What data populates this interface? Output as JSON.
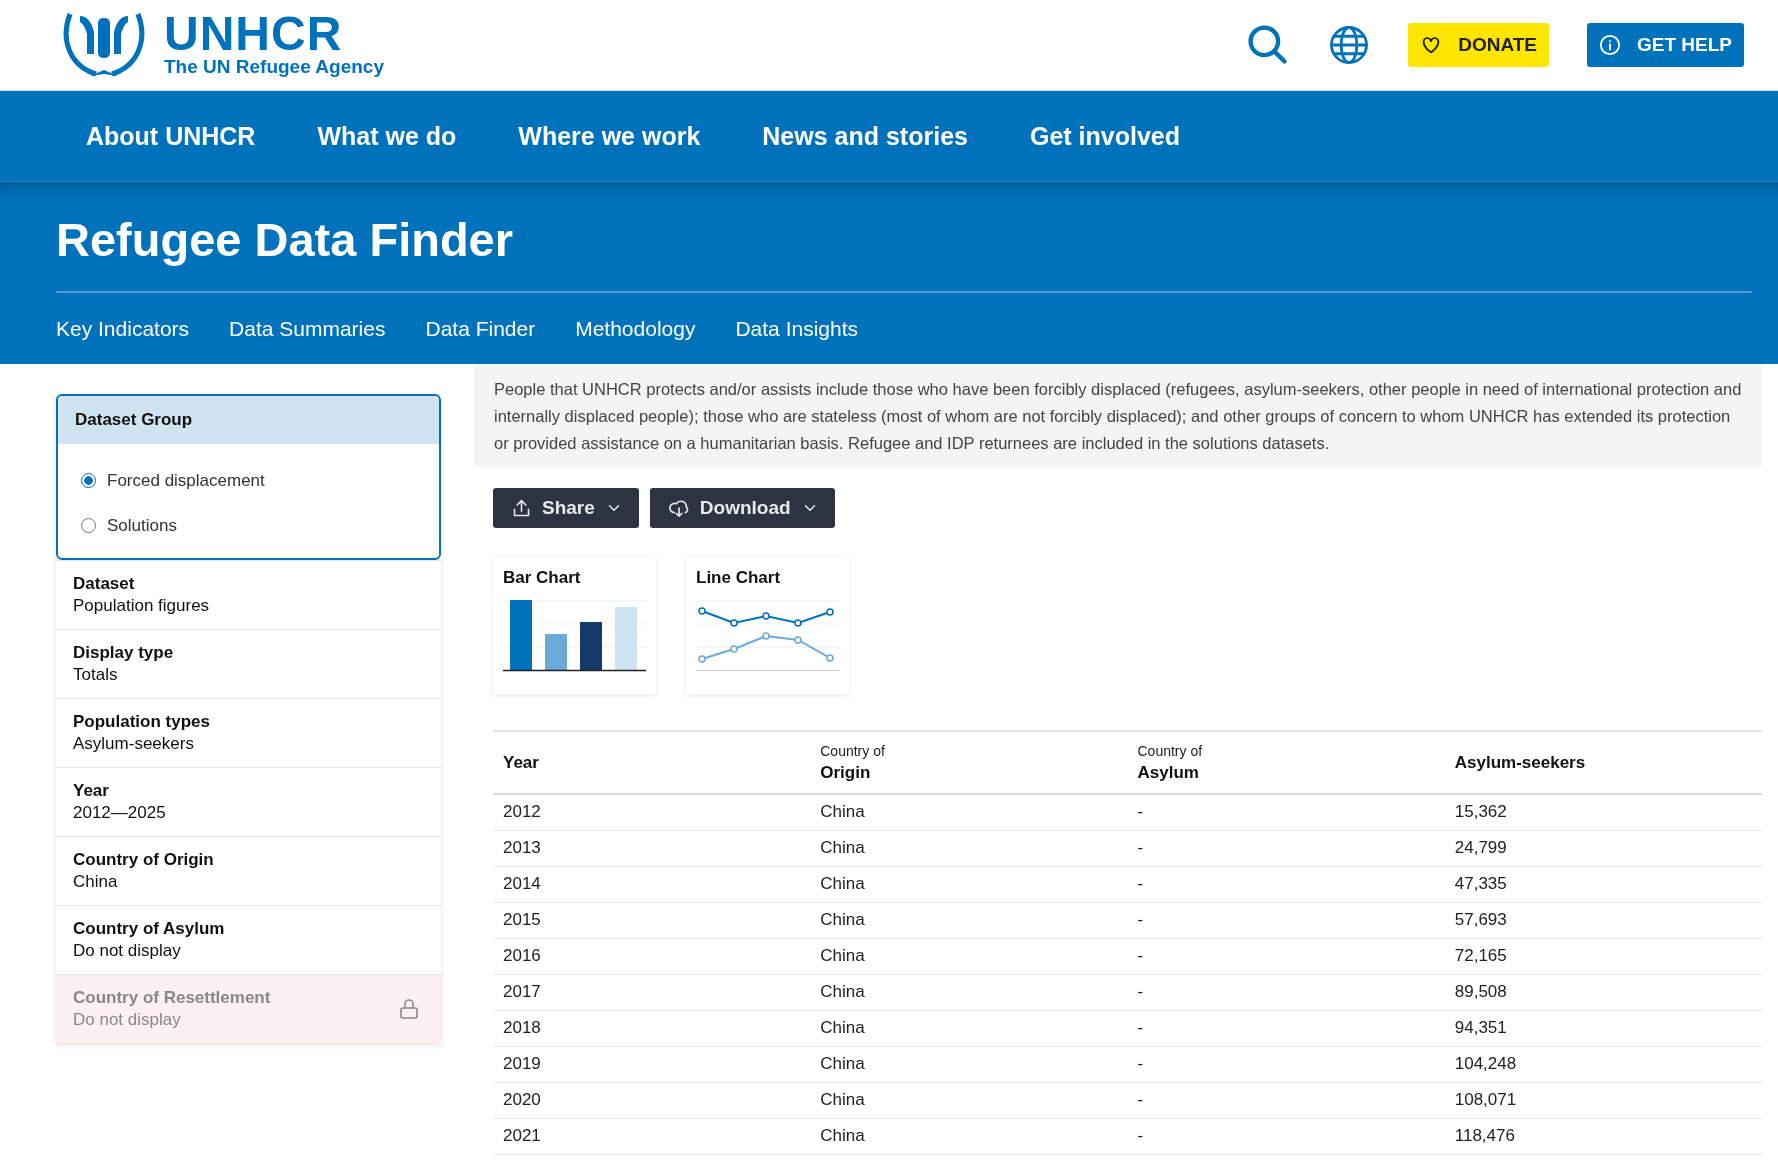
{
  "header": {
    "logo": {
      "name": "UNHCR",
      "tagline": "The UN Refugee Agency"
    },
    "actions": [
      {
        "kind": "search"
      },
      {
        "kind": "language"
      },
      {
        "kind": "donate",
        "label": "DONATE"
      },
      {
        "kind": "help",
        "label": "GET HELP"
      }
    ]
  },
  "nav": {
    "items": [
      "About UNHCR",
      "What we do",
      "Where we work",
      "News and stories",
      "Get involved"
    ]
  },
  "page_title": "Refugee Data Finder",
  "subnav": {
    "items": [
      "Key Indicators",
      "Data Summaries",
      "Data Finder",
      "Methodology",
      "Data Insights"
    ]
  },
  "sidebar": {
    "dataset_group": {
      "title": "Dataset Group",
      "options": [
        {
          "label": "Forced displacement",
          "selected": true
        },
        {
          "label": "Solutions",
          "selected": false
        }
      ]
    },
    "filters": [
      {
        "label": "Dataset",
        "value": "Population figures",
        "disabled": false
      },
      {
        "label": "Display type",
        "value": "Totals",
        "disabled": false
      },
      {
        "label": "Population types",
        "value": "Asylum-seekers",
        "disabled": false
      },
      {
        "label": "Year",
        "value": "2012—2025",
        "disabled": false
      },
      {
        "label": "Country of Origin",
        "value": "China",
        "disabled": false
      },
      {
        "label": "Country of Asylum",
        "value": "Do not display",
        "disabled": false
      },
      {
        "label": "Country of Resettlement",
        "value": "Do not display",
        "disabled": true
      }
    ]
  },
  "description": "People that UNHCR protects and/or assists include those who have been forcibly displaced (refugees, asylum-seekers, other people in need of international protection and internally displaced people); those who are stateless (most of whom are not forcibly displaced); and other groups of concern to whom UNHCR has extended its protection or provided assistance on a humanitarian basis. Refugee and IDP returnees are included in the solutions datasets.",
  "toolbar": [
    {
      "kind": "share",
      "label": "Share"
    },
    {
      "kind": "download",
      "label": "Download"
    }
  ],
  "chart_types": [
    {
      "kind": "bar",
      "label": "Bar Chart"
    },
    {
      "kind": "line",
      "label": "Line Chart"
    }
  ],
  "table": {
    "columns": [
      {
        "label": "Year"
      },
      {
        "prefix": "Country of",
        "label": "Origin"
      },
      {
        "prefix": "Country of",
        "label": "Asylum"
      },
      {
        "label": "Asylum-seekers"
      }
    ],
    "rows": [
      [
        "2012",
        "China",
        "-",
        "15,362"
      ],
      [
        "2013",
        "China",
        "-",
        "24,799"
      ],
      [
        "2014",
        "China",
        "-",
        "47,335"
      ],
      [
        "2015",
        "China",
        "-",
        "57,693"
      ],
      [
        "2016",
        "China",
        "-",
        "72,165"
      ],
      [
        "2017",
        "China",
        "-",
        "89,508"
      ],
      [
        "2018",
        "China",
        "-",
        "94,351"
      ],
      [
        "2019",
        "China",
        "-",
        "104,248"
      ],
      [
        "2020",
        "China",
        "-",
        "108,071"
      ],
      [
        "2021",
        "China",
        "-",
        "118,476"
      ]
    ]
  }
}
